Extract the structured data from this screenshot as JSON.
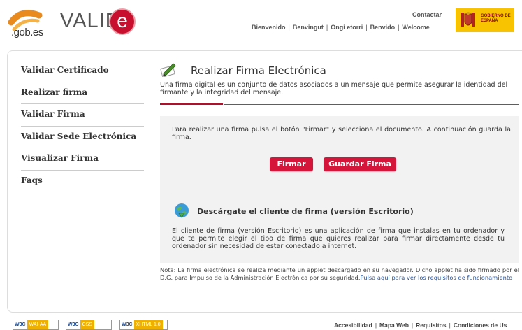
{
  "header": {
    "logo_gob_text": ".gob.es",
    "logo_valide_text": "VALID",
    "logo_e_text": "e",
    "contactar": "Contactar",
    "languages": [
      "Bienvenido",
      "Benvingut",
      "Ongi etorri",
      "Benvido",
      "Welcome"
    ],
    "gov_logo_text": "GOBIERNO DE ESPAÑA"
  },
  "sidebar": {
    "items": [
      {
        "label": "Validar Certificado"
      },
      {
        "label": "Realizar firma"
      },
      {
        "label": "Validar Firma"
      },
      {
        "label": "Validar Sede Electrónica"
      },
      {
        "label": "Visualizar Firma"
      },
      {
        "label": "Faqs"
      }
    ]
  },
  "main": {
    "title": "Realizar Firma Electrónica",
    "description": "Una firma digital es un conjunto de datos asociados a un mensaje que permite asegurar la identidad del firmante y la integridad del mensaje.",
    "instructions": "Para realizar una firma pulsa el botón \"Firmar\" y selecciona el documento. A continuación guarda la firma.",
    "buttons": {
      "firmar": "Firmar",
      "guardar": "Guardar Firma"
    },
    "client_title": "Descárgate el cliente de firma (versión Escritorio)",
    "client_description": "El cliente de firma (versión Escritorio) es una aplicación de firma que instalas en tu ordenador y que te permite elegir el tipo de firma que quieres realizar para firmar directamente desde tu ordenador sin necesidad de estar conectado a internet.",
    "note_text": "Nota: La firma electrónica se realiza mediante un applet descargado en su navegador. Dicho applet ha sido firmado por el D.G. para Impulso de la Administración Electrónica por su seguridad.",
    "note_link": "Pulsa aquí para ver los requisitos de funcionamiento"
  },
  "footer": {
    "badges": [
      {
        "w3c": "W3C",
        "label": "WAI-AA"
      },
      {
        "w3c": "W3C",
        "label": "CSS"
      },
      {
        "w3c": "W3C",
        "label": "XHTML 1.0"
      }
    ],
    "links": [
      "Accesibilidad",
      "Mapa Web",
      "Requisitos",
      "Condiciones de Us"
    ]
  },
  "colors": {
    "accent": "#d6153a",
    "brand_red": "#c8102e",
    "gov_yellow": "#f8c300"
  }
}
